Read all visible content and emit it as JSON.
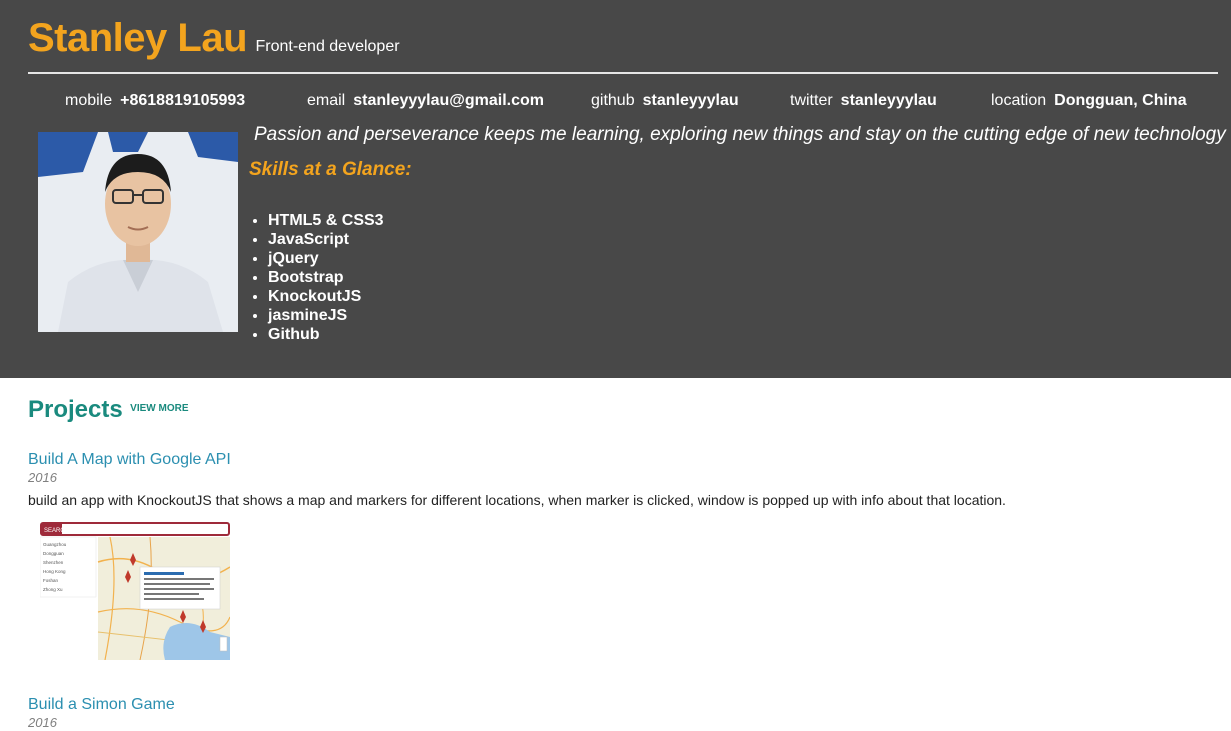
{
  "header": {
    "name": "Stanley Lau",
    "role": "Front-end developer",
    "contacts": [
      {
        "label": "mobile",
        "value": "+8618819105993"
      },
      {
        "label": "email",
        "value": "stanleyyylau@gmail.com"
      },
      {
        "label": "github",
        "value": "stanleyyylau"
      },
      {
        "label": "twitter",
        "value": "stanleyyylau"
      },
      {
        "label": "location",
        "value": "Dongguan, China"
      }
    ],
    "tagline": "Passion and perseverance keeps me learning, exploring new things and stay on the cutting edge of new technology",
    "skills_title": "Skills at a Glance:",
    "skills": [
      "HTML5 & CSS3",
      "JavaScript",
      "jQuery",
      "Bootstrap",
      "KnockoutJS",
      "jasmineJS",
      "Github"
    ]
  },
  "projects": {
    "title": "Projects",
    "view_more": "VIEW MORE",
    "items": [
      {
        "title": "Build A Map with Google API",
        "year": "2016",
        "description": "build an app with KnockoutJS that shows a map and markers for different locations, when marker is clicked, window is popped up with info about that location.",
        "thumb": {
          "search_label": "SEARCH",
          "list": [
            "Guangzhou",
            "Dongguan",
            "Shenzhen",
            "Hong Kong",
            "Foshan",
            "Zhong Xu"
          ]
        }
      },
      {
        "title": "Build a Simon Game",
        "year": "2016"
      }
    ]
  },
  "colors": {
    "header_bg": "#484848",
    "accent_orange": "#f3a41e",
    "projects_teal": "#1a8a7e",
    "link_blue": "#2b8fb0"
  }
}
